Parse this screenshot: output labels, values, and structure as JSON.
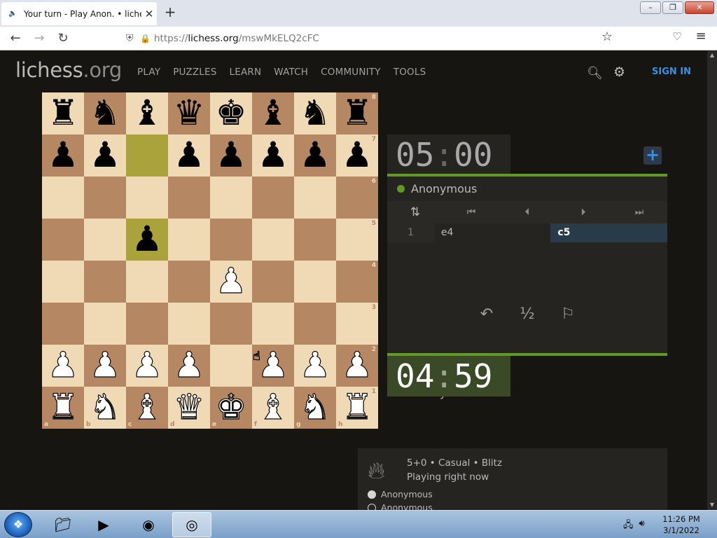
{
  "browser": {
    "tab_title": "Your turn - Play Anon. • liches",
    "url_host": "lichess.org",
    "url_path": "/mswMkELQ2cFC",
    "url_scheme": "https://"
  },
  "site": {
    "logo_main": "lichess",
    "logo_domain": ".org",
    "nav": [
      "PLAY",
      "PUZZLES",
      "LEARN",
      "WATCH",
      "COMMUNITY",
      "TOOLS"
    ],
    "sign_in": "SIGN IN"
  },
  "board": {
    "files": [
      "a",
      "b",
      "c",
      "d",
      "e",
      "f",
      "g",
      "h"
    ],
    "ranks": [
      "8",
      "7",
      "6",
      "5",
      "4",
      "3",
      "2",
      "1"
    ],
    "highlight_squares": [
      "c7",
      "c5"
    ],
    "pieces": {
      "a8": "br",
      "b8": "bn",
      "c8": "bb",
      "d8": "bq",
      "e8": "bk",
      "f8": "bb",
      "g8": "bn",
      "h8": "br",
      "a7": "bp",
      "b7": "bp",
      "d7": "bp",
      "e7": "bp",
      "f7": "bp",
      "g7": "bp",
      "h7": "bp",
      "c5": "bp",
      "e4": "wp",
      "a2": "wp",
      "b2": "wp",
      "c2": "wp",
      "d2": "wp",
      "f2": "wp",
      "g2": "wp",
      "h2": "wp",
      "a1": "wr",
      "b1": "wn",
      "c1": "wb",
      "d1": "wq",
      "e1": "wk",
      "f1": "wb",
      "g1": "wn",
      "h1": "wr"
    },
    "colors": {
      "light": "#f0dab5",
      "dark": "#b58763"
    }
  },
  "game": {
    "top_clock": {
      "min": "05",
      "sep": ":",
      "sec": "00"
    },
    "bottom_clock": {
      "min": "04",
      "sep": ":",
      "sec": "59"
    },
    "top_player": "Anonymous",
    "bottom_player": "Anonymous",
    "moves": [
      {
        "num": "1",
        "white": "e4",
        "black": "c5"
      }
    ],
    "draw_label": "½",
    "accent_color": "#629924"
  },
  "game_info": {
    "line1": "5+0 • Casual • Blitz",
    "line2": "Playing right now",
    "players": [
      "Anonymous",
      "Anonymous"
    ]
  },
  "taskbar": {
    "time": "11:26 PM",
    "date": "3/1/2022"
  }
}
